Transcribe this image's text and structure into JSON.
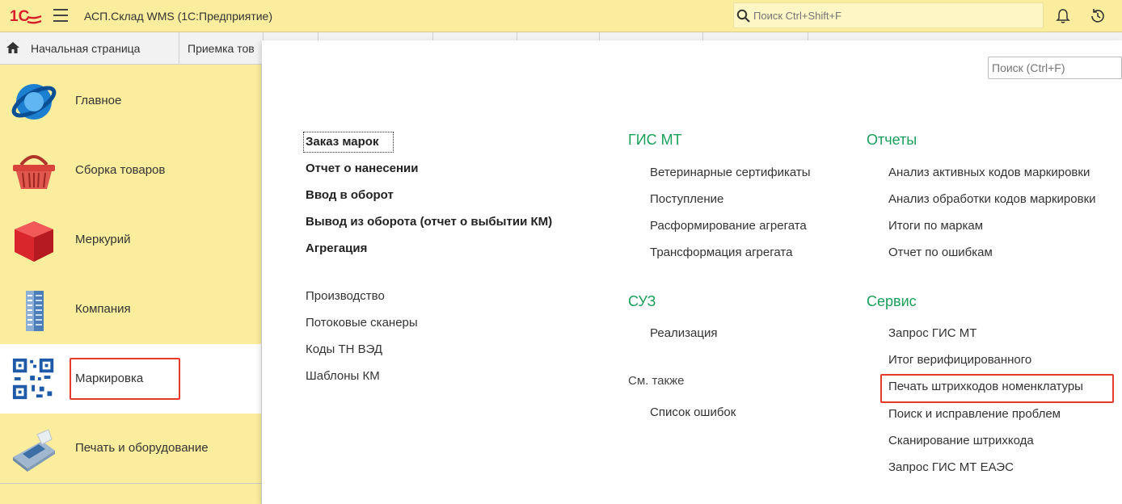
{
  "app": {
    "logo_text": "1С",
    "title": "АСП.Склад WMS  (1С:Предприятие)"
  },
  "search": {
    "global_placeholder": "Поиск Ctrl+Shift+F",
    "local_placeholder": "Поиск (Ctrl+F)"
  },
  "tabs": [
    {
      "label": "Начальная страница"
    },
    {
      "label": "Приемка тов"
    }
  ],
  "sidebar": {
    "items": [
      {
        "label": "Главное",
        "icon": "globe-icon"
      },
      {
        "label": "Сборка товаров",
        "icon": "basket-icon"
      },
      {
        "label": "Меркурий",
        "icon": "cube-icon"
      },
      {
        "label": "Компания",
        "icon": "building-icon"
      },
      {
        "label": "Маркировка",
        "icon": "qr-code-icon",
        "active": true
      },
      {
        "label": "Печать и оборудование",
        "icon": "pos-terminal-icon"
      }
    ]
  },
  "main": {
    "col1": {
      "bold_links": [
        "Заказ марок",
        "Отчет о нанесении",
        "Ввод в оборот",
        "Вывод из оборота (отчет о выбытии КМ)",
        "Агрегация"
      ],
      "links": [
        "Производство",
        "Потоковые сканеры",
        "Коды ТН ВЭД",
        "Шаблоны КМ"
      ]
    },
    "col2": {
      "gis_heading": "ГИС МТ",
      "gis_links": [
        "Ветеринарные сертификаты",
        "Поступление",
        "Расформирование агрегата",
        "Трансформация агрегата"
      ],
      "suz_heading": "СУЗ",
      "suz_links": [
        "Реализация"
      ],
      "see_also_heading": "См. также",
      "see_also_links": [
        "Список ошибок"
      ]
    },
    "col3": {
      "reports_heading": "Отчеты",
      "reports_links": [
        "Анализ активных кодов маркировки",
        "Анализ обработки кодов маркировки",
        "Итоги по маркам",
        "Отчет по ошибкам"
      ],
      "service_heading": "Сервис",
      "service_links": [
        "Запрос ГИС МТ",
        "Итог верифицированного",
        "Печать штрихкодов номенклатуры",
        "Поиск и исправление проблем",
        "Сканирование штрихкода",
        "Запрос ГИС МТ ЕАЭС"
      ]
    }
  },
  "colors": {
    "accent_yellow": "#fbed9e",
    "heading_green": "#19a05a",
    "highlight_red": "#e53a2e",
    "logo_red": "#d8202a"
  }
}
